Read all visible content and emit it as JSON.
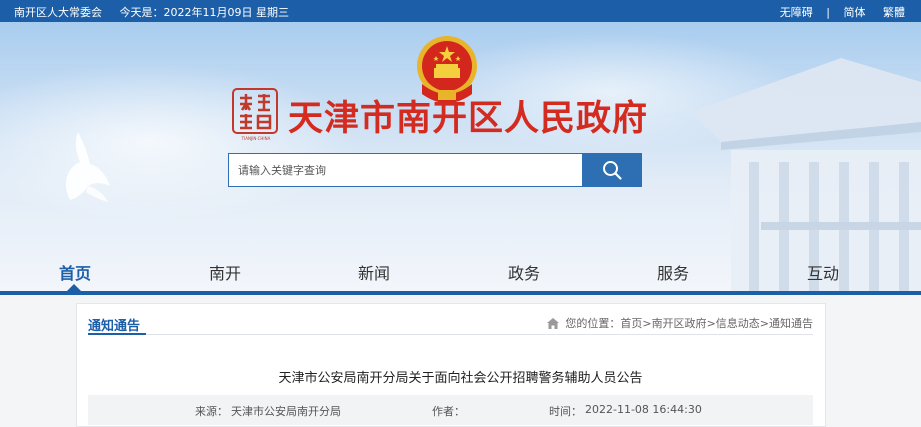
{
  "topbar": {
    "org": "南开区人大常委会",
    "date": "今天是：2022年11月09日 星期三",
    "accessibility": "无障碍",
    "separator": "|",
    "simplified": "简体",
    "traditional": "繁體"
  },
  "header": {
    "logo_caption": "TIANJIN·CHINA",
    "site_title": "天津市南开区人民政府",
    "search_placeholder": "请输入关键字查询"
  },
  "nav": {
    "items": [
      "首页",
      "南开",
      "新闻",
      "政务",
      "服务",
      "互动"
    ],
    "active_index": 0
  },
  "section": {
    "title": "通知通告",
    "breadcrumb_prefix": "您的位置：",
    "breadcrumb": [
      "首页",
      "南开区政府",
      "信息动态",
      "通知通告"
    ],
    "breadcrumb_sep": ">"
  },
  "article": {
    "title": "天津市公安局南开分局关于面向社会公开招聘警务辅助人员公告",
    "source_label": "来源：",
    "source": "天津市公安局南开分局",
    "author_label": "作者：",
    "author": "",
    "time_label": "时间：",
    "time": "2022-11-08 16:44:30"
  },
  "colors": {
    "brand_blue": "#1c5fa8",
    "title_red": "#d42b20"
  }
}
